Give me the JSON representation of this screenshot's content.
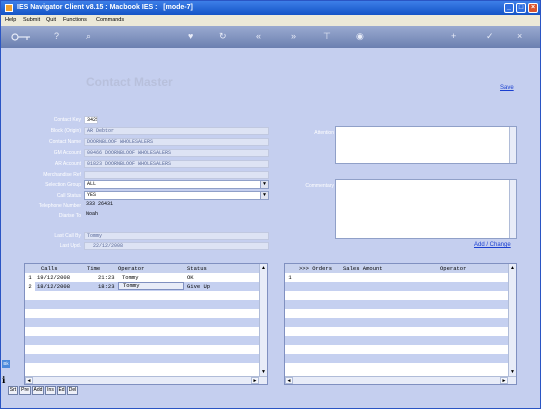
{
  "window": {
    "title": "IES Navigator Client v8.15 : Macbook IES :",
    "mode": "[mode-7]",
    "minimize_glyph": "_",
    "maximize_glyph": "□",
    "close_glyph": "×"
  },
  "menu": [
    "Help",
    "Submit",
    "Quit",
    "Functions",
    "Commands"
  ],
  "toolbar": {
    "key_icon": "key-icon",
    "help_glyph": "?",
    "search_glyph": "⌕",
    "heart_glyph": "♥",
    "refresh_glyph": "↻",
    "back_glyph": "«",
    "forward_glyph": "»",
    "tree_glyph": "⊤",
    "stop_glyph": "◉",
    "add_glyph": "+",
    "ok_glyph": "✓",
    "cancel_glyph": "×"
  },
  "form": {
    "heading": "Contact Master",
    "save_label": "Save",
    "fields": [
      {
        "label": "Contact Key",
        "value": "3425"
      },
      {
        "label": "Block (Origin)",
        "value": "AR Debtor"
      },
      {
        "label": "Contact Name",
        "value": "DOORNBLOOF WHOLESALERS"
      },
      {
        "label": "GM Account",
        "value": "00466 DOORNBLOOF WHOLESALERS"
      },
      {
        "label": "AR Account",
        "value": "01823 DOORNBLOOF WHOLESALERS"
      },
      {
        "label": "Merchandise Ref",
        "value": ""
      },
      {
        "label": "Selection Group",
        "value": "ALL"
      },
      {
        "label": "Call Status",
        "value": "YES"
      },
      {
        "label": "Telephone Number",
        "value": "333 26431"
      },
      {
        "label": "Diarise To",
        "value": "Noah"
      },
      {
        "label": "Last Call By",
        "value": "Tommy"
      },
      {
        "label": "Last Upd.",
        "value": "22/12/2008"
      }
    ],
    "attention_label": "Attention",
    "commentary_label": "Commentary",
    "add_change_label": "Add / Change"
  },
  "calls_grid": {
    "headers": [
      "Calls",
      "Time",
      "Operator",
      "Status"
    ],
    "rows": [
      {
        "num": "1",
        "date": "19/12/2008",
        "time": "21:23",
        "operator": "Tommy",
        "status": "OK"
      },
      {
        "num": "2",
        "date": "18/12/2008",
        "time": "18:23",
        "operator": "Tommy",
        "status": "Give Up"
      }
    ]
  },
  "orders_grid": {
    "headers": [
      ">>> Orders",
      "Sales Amount",
      "Operator"
    ],
    "rows": [
      {
        "num": "1"
      }
    ]
  },
  "bottom_buttons": [
    "Srt",
    "Pre",
    "Add",
    "Ins",
    "Ed",
    "Del"
  ],
  "side_tab": "Bk",
  "scroll": {
    "up": "▲",
    "down": "▼",
    "left": "◄",
    "right": "►"
  }
}
